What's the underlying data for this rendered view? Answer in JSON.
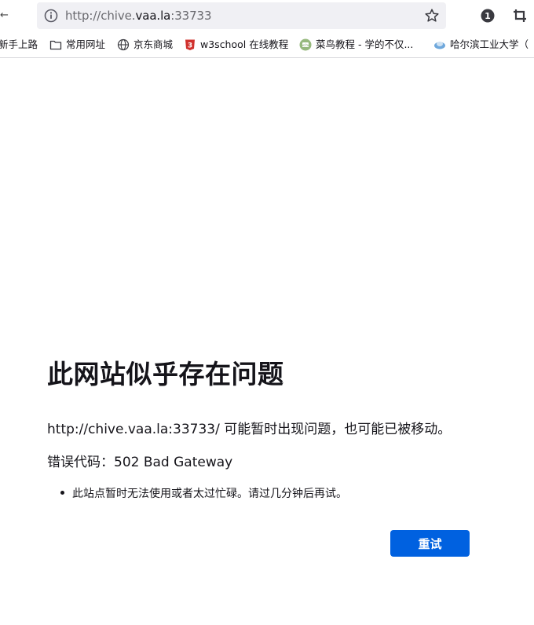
{
  "browser": {
    "back_fragment": "←",
    "url_scheme": "http://chive.",
    "url_host": "vaa.la",
    "url_port": ":33733",
    "colors": {
      "urlbar_bg": "#f0f0f4",
      "accent": "#0061e0"
    }
  },
  "bookmarks": [
    {
      "label": "新手上路",
      "icon": "none"
    },
    {
      "label": "常用网址",
      "icon": "folder-icon"
    },
    {
      "label": "京东商城",
      "icon": "globe-icon"
    },
    {
      "label": "w3school 在线教程",
      "icon": "w3school-logo-icon"
    },
    {
      "label": "菜鸟教程 - 学的不仅...",
      "icon": "runoob-logo-icon"
    },
    {
      "label": "哈尔滨工业大学（",
      "icon": "hit-logo-icon"
    }
  ],
  "error": {
    "title": "此网站似乎存在问题",
    "description": "http://chive.vaa.la:33733/ 可能暂时出现问题，也可能已被移动。",
    "code": "错误代码：502 Bad Gateway",
    "hints": [
      "此站点暂时无法使用或者太过忙碌。请过几分钟后再试。"
    ],
    "retry_label": "重试"
  }
}
